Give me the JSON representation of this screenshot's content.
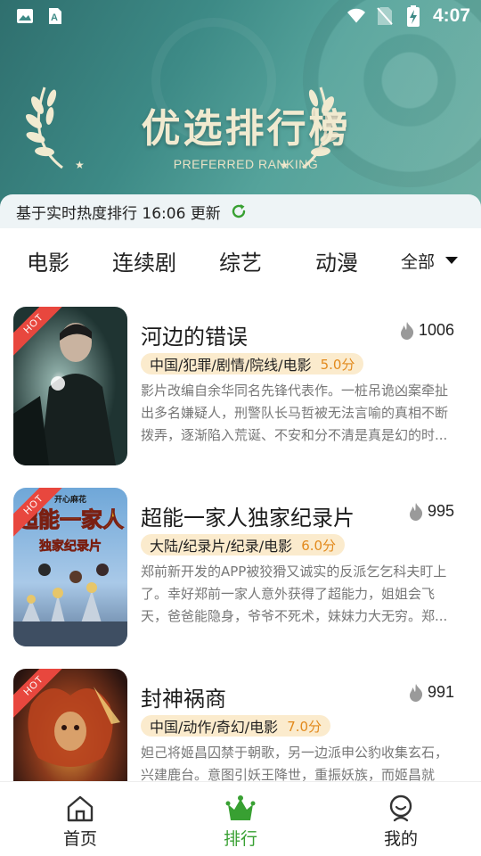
{
  "status_bar": {
    "time": "4:07",
    "left_icons": [
      "image-icon",
      "font-icon"
    ],
    "right_icons": [
      "wifi-icon",
      "no-sim-icon",
      "battery-charging-icon"
    ]
  },
  "banner": {
    "title": "优选排行榜",
    "subtitle": "PREFERRED RANKING"
  },
  "update_strip": {
    "text": "基于实时热度排行 16:06 更新",
    "icon": "refresh-icon"
  },
  "tabs": {
    "items": [
      "电影",
      "连续剧",
      "综艺",
      "动漫"
    ],
    "all_label": "全部"
  },
  "list": [
    {
      "title": "河边的错误",
      "heat": "1006",
      "tags": "中国/犯罪/剧情/院线/电影",
      "score": "5.0分",
      "hot": "HOT",
      "description": "影片改编自余华同名先锋代表作。一桩吊诡凶案牵扯出多名嫌疑人，刑警队长马哲被无法言喻的真相不断拨弄，逐渐陷入荒诞、不安和分不清是真是幻的时..."
    },
    {
      "title": "超能一家人独家纪录片",
      "heat": "995",
      "tags": "大陆/纪录片/纪录/电影",
      "score": "6.0分",
      "hot": "HOT",
      "poster_text_top": "开心麻花",
      "poster_text_main": "超能一家人",
      "poster_text_sub": "独家纪录片",
      "description": "郑前新开发的APP被狡猾又诚实的反派乞乞科夫盯上了。幸好郑前一家人意外获得了超能力，姐姐会飞天，爸爸能隐身，爷爷不死术，妹妹力大无穷。郑..."
    },
    {
      "title": "封神祸商",
      "heat": "991",
      "tags": "中国/动作/奇幻/电影",
      "score": "7.0分",
      "hot": "HOT",
      "description": "妲己将姬昌囚禁于朝歌，另一边派申公豹收集玄石，兴建鹿台。意图引妖王降世，重振妖族，而姬昌就是..."
    }
  ],
  "bottom_nav": [
    {
      "label": "首页",
      "icon": "home-icon",
      "active": false
    },
    {
      "label": "排行",
      "icon": "ranking-icon",
      "active": true
    },
    {
      "label": "我的",
      "icon": "profile-icon",
      "active": false
    }
  ],
  "colors": {
    "accent": "#38a032",
    "score": "#e28a1d",
    "tag_bg": "#fbebcd",
    "hot_badge": "#e8473e",
    "banner": "#3d8a86"
  }
}
